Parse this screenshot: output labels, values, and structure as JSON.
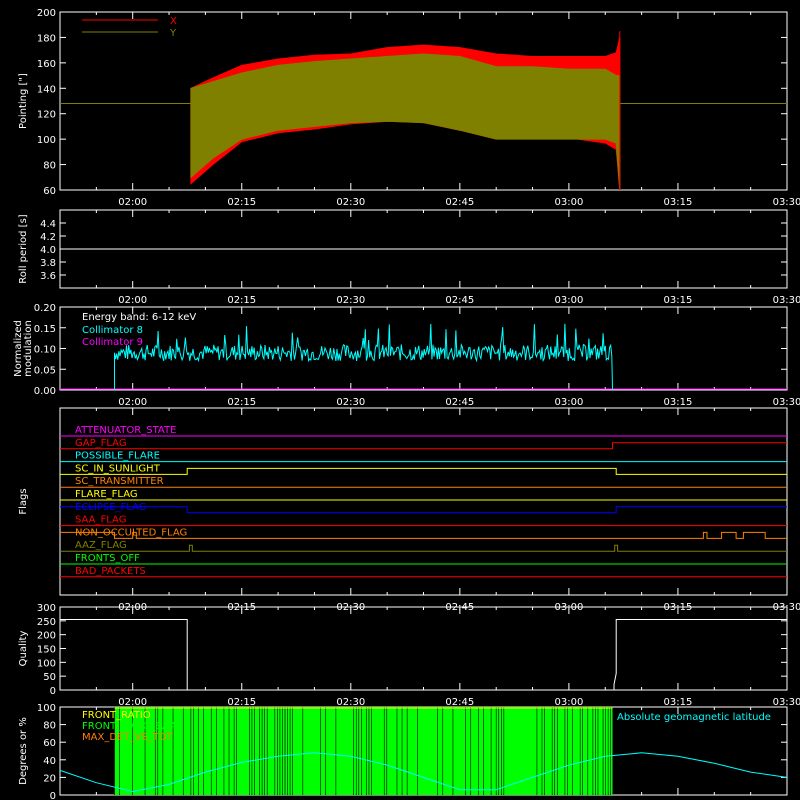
{
  "colors": {
    "background": "#000000",
    "axes": "#ffffff",
    "x_red": "#ff0000",
    "y_olive": "#808000",
    "cyan": "#00ffff",
    "magenta": "#ff00ff",
    "green": "#00ff00",
    "yellow": "#ffff00",
    "orange": "#ff8000",
    "blue": "#0000ff"
  },
  "time_axis": {
    "ticks": [
      "02:00",
      "02:15",
      "02:30",
      "02:45",
      "03:00",
      "03:15",
      "03:30"
    ],
    "range_minutes": [
      110,
      210
    ]
  },
  "chart_data": [
    {
      "type": "area",
      "ylabel": "Pointing [\"]",
      "ylim": [
        60,
        200
      ],
      "yticks": [
        "60",
        "80",
        "100",
        "120",
        "140",
        "160",
        "180",
        "200"
      ],
      "legend_placement": "top-left",
      "series": [
        {
          "name": "X",
          "color": "#ff0000",
          "x": [
            128,
            131,
            135,
            140,
            145,
            150,
            155,
            160,
            165,
            170,
            175,
            180,
            185,
            186.5,
            187
          ],
          "upper": [
            140,
            148,
            158,
            163,
            166,
            167,
            172,
            174,
            172,
            167,
            165,
            165,
            165,
            168,
            180
          ],
          "lower": [
            65,
            80,
            98,
            105,
            108,
            112,
            114,
            113,
            107,
            100,
            101,
            101,
            97,
            92,
            60
          ]
        },
        {
          "name": "Y",
          "color": "#808000",
          "x": [
            128,
            131,
            135,
            140,
            145,
            150,
            155,
            160,
            165,
            170,
            175,
            180,
            185,
            186.5,
            187
          ],
          "upper": [
            140,
            145,
            152,
            158,
            161,
            163,
            165,
            167,
            165,
            157,
            157,
            155,
            155,
            150,
            150
          ],
          "lower": [
            70,
            85,
            100,
            107,
            110,
            113,
            114,
            113,
            107,
            100,
            100,
            100,
            100,
            97,
            60
          ]
        }
      ],
      "baseline_value": 128
    },
    {
      "type": "line",
      "ylabel": "Roll period [s]",
      "ylim": [
        3.4,
        4.6
      ],
      "yticks": [
        "3.6",
        "3.8",
        "4.0",
        "4.2",
        "4.4"
      ],
      "series": [
        {
          "color": "#ffffff",
          "x": [
            110,
            210
          ],
          "y": [
            4.0,
            4.0
          ]
        }
      ]
    },
    {
      "type": "line",
      "ylabel": "Normalized modulation",
      "ylim": [
        0,
        0.2
      ],
      "yticks": [
        "0.00",
        "0.05",
        "0.10",
        "0.15",
        "0.20"
      ],
      "annotation": "Energy band: 6-12 keV",
      "legend_placement": "top-left",
      "series": [
        {
          "name": "Collimator 8",
          "color": "#00ffff",
          "x_start": 117.5,
          "x_end": 186,
          "mean": 0.09,
          "jitter": 0.02
        },
        {
          "name": "Collimator 9",
          "color": "#ff00ff",
          "x": [
            110,
            210
          ],
          "y": [
            0,
            0
          ]
        }
      ]
    },
    {
      "type": "line",
      "ylabel": "Flags",
      "flags": [
        {
          "name": "ATTENUATOR_STATE",
          "color": "#ff00ff",
          "segments": [
            [
              110,
              0
            ],
            [
              210,
              0
            ]
          ]
        },
        {
          "name": "GAP_FLAG",
          "color": "#ff0000",
          "segments": [
            [
              110,
              0
            ],
            [
              186,
              0
            ],
            [
              186,
              1
            ],
            [
              210,
              1
            ]
          ]
        },
        {
          "name": "POSSIBLE_FLARE",
          "color": "#00ffff",
          "segments": [
            [
              110,
              0
            ],
            [
              210,
              0
            ]
          ]
        },
        {
          "name": "SC_IN_SUNLIGHT",
          "color": "#ffff00",
          "segments": [
            [
              110,
              0
            ],
            [
              127.5,
              0
            ],
            [
              127.5,
              1
            ],
            [
              186.5,
              1
            ],
            [
              186.5,
              0
            ],
            [
              210,
              0
            ]
          ]
        },
        {
          "name": "SC_TRANSMITTER",
          "color": "#ff8000",
          "segments": [
            [
              110,
              0
            ],
            [
              210,
              0
            ]
          ]
        },
        {
          "name": "FLARE_FLAG",
          "color": "#ffff00",
          "segments": [
            [
              110,
              0
            ],
            [
              210,
              0
            ]
          ]
        },
        {
          "name": "ECLIPSE_FLAG",
          "color": "#0000ff",
          "segments": [
            [
              110,
              1
            ],
            [
              127.5,
              1
            ],
            [
              127.5,
              0
            ],
            [
              186.5,
              0
            ],
            [
              186.5,
              1
            ],
            [
              210,
              1
            ]
          ]
        },
        {
          "name": "SAA_FLAG",
          "color": "#ff0000",
          "segments": [
            [
              110,
              0
            ],
            [
              210,
              0
            ]
          ]
        },
        {
          "name": "NON_OCCULTED_FLAG",
          "color": "#ff8000",
          "segments": [
            [
              110,
              1
            ],
            [
              117.5,
              1
            ],
            [
              117.5,
              0
            ],
            [
              120,
              0
            ],
            [
              120,
              1
            ],
            [
              120.5,
              1
            ],
            [
              120.5,
              0
            ],
            [
              198.5,
              0
            ],
            [
              198.5,
              1
            ],
            [
              199,
              1
            ],
            [
              199,
              0
            ],
            [
              201,
              0
            ],
            [
              201,
              1
            ],
            [
              203,
              1
            ],
            [
              203,
              0
            ],
            [
              204,
              0
            ],
            [
              204,
              1
            ],
            [
              207,
              1
            ],
            [
              207,
              0
            ],
            [
              210,
              0
            ]
          ]
        },
        {
          "name": "AAZ_FLAG",
          "color": "#808000",
          "segments": [
            [
              110,
              0
            ],
            [
              127.8,
              0
            ],
            [
              127.8,
              1
            ],
            [
              128.2,
              1
            ],
            [
              128.2,
              0
            ],
            [
              186.3,
              0
            ],
            [
              186.3,
              1
            ],
            [
              186.7,
              1
            ],
            [
              186.7,
              0
            ],
            [
              210,
              0
            ]
          ]
        },
        {
          "name": "FRONTS_OFF",
          "color": "#00ff00",
          "segments": [
            [
              110,
              0
            ],
            [
              210,
              0
            ]
          ]
        },
        {
          "name": "BAD_PACKETS",
          "color": "#ff0000",
          "segments": [
            [
              110,
              0
            ],
            [
              210,
              0
            ]
          ]
        }
      ],
      "flag_labels": [
        "ATTENUATOR_STATE",
        "GAP_FLAG",
        "POSSIBLE_FLARE",
        "SC_IN_SUNLIGHT",
        "SC_TRANSMITTER",
        "FLARE_FLAG",
        "ECLIPSE_FLAG",
        "SAA_FLAG",
        "NON_OCCULTED_FLAG",
        "AAZ_FLAG",
        "FRONTS_OFF",
        "BAD_PACKETS"
      ]
    },
    {
      "type": "line",
      "ylabel": "Quality",
      "ylim": [
        0,
        300
      ],
      "yticks": [
        "0",
        "50",
        "100",
        "150",
        "200",
        "250",
        "300"
      ],
      "series": [
        {
          "color": "#ffffff",
          "x": [
            110,
            127.5,
            127.5,
            186.2,
            186.2,
            186.5,
            186.5,
            210
          ],
          "y": [
            255,
            255,
            0,
            0,
            20,
            60,
            255,
            255
          ]
        }
      ]
    },
    {
      "type": "bar",
      "ylabel": "Degrees or %",
      "ylim": [
        0,
        100
      ],
      "yticks": [
        "0",
        "20",
        "40",
        "60",
        "80",
        "100"
      ],
      "legend_placement": "top-left",
      "legend": [
        {
          "name": "FRONT_RATIO",
          "color": "#ffff00"
        },
        {
          "name": "FRONT_RATIO_SAA",
          "color": "#00ff00"
        },
        {
          "name": "MAX_DET_VS_TOT",
          "color": "#ff8000"
        }
      ],
      "annotation": "Absolute geomagnetic latitude",
      "bars": {
        "color": "#00ff00",
        "x_start": 117.5,
        "x_end": 186,
        "value": 100
      },
      "latitude": {
        "color": "#00ffff",
        "x": [
          110,
          115,
          120,
          125,
          130,
          135,
          140,
          145,
          150,
          155,
          160,
          165,
          170,
          175,
          180,
          185,
          190,
          195,
          200,
          205,
          210
        ],
        "y": [
          28,
          14,
          4,
          12,
          26,
          37,
          44,
          48,
          44,
          34,
          20,
          6,
          6,
          20,
          34,
          44,
          48,
          44,
          36,
          26,
          20
        ]
      }
    }
  ]
}
